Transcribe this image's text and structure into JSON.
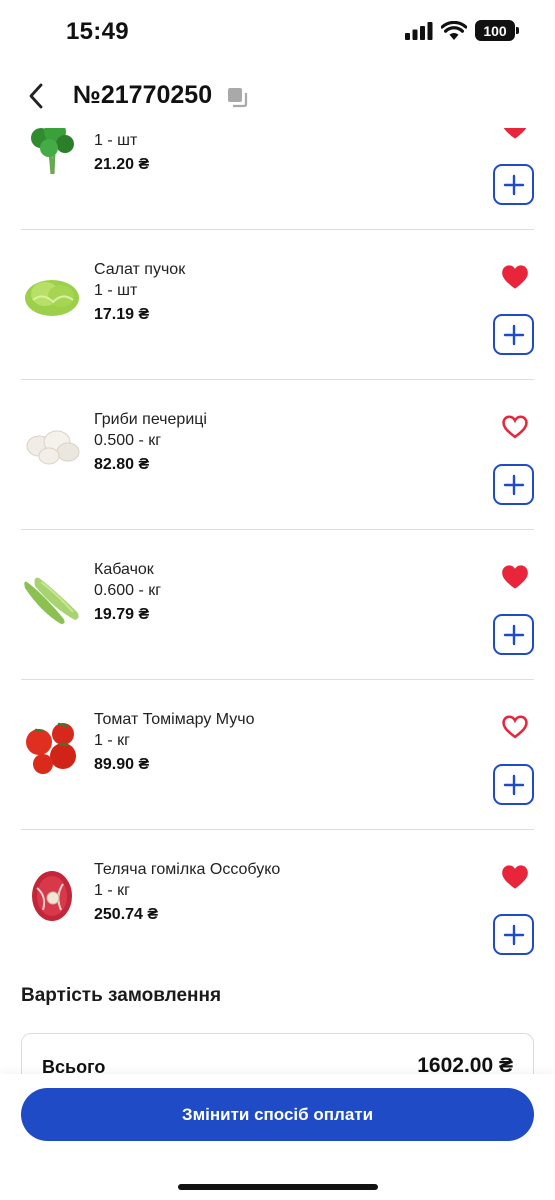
{
  "status_bar": {
    "time": "15:49",
    "battery": "100"
  },
  "header": {
    "order_number": "№21770250"
  },
  "items": [
    {
      "name": "",
      "quantity": "1 - шт",
      "price": "21.20 ₴",
      "favorite": true,
      "image": "herb-bunch"
    },
    {
      "name": "Салат пучок",
      "quantity": "1 - шт",
      "price": "17.19 ₴",
      "favorite": true,
      "image": "lettuce"
    },
    {
      "name": "Гриби печериці",
      "quantity": "0.500 - кг",
      "price": "82.80 ₴",
      "favorite": false,
      "image": "mushrooms"
    },
    {
      "name": "Кабачок",
      "quantity": "0.600 - кг",
      "price": "19.79 ₴",
      "favorite": true,
      "image": "zucchini"
    },
    {
      "name": "Томат Томімару Мучо",
      "quantity": "1 - кг",
      "price": "89.90 ₴",
      "favorite": false,
      "image": "tomatoes"
    },
    {
      "name": "Теляча гомілка Оссобуко",
      "quantity": "1 - кг",
      "price": "250.74 ₴",
      "favorite": true,
      "image": "veal-shank"
    }
  ],
  "order_cost": {
    "title": "Вартість замовлення",
    "total_label": "Всього",
    "total_value": "1602.00 ₴"
  },
  "actions": {
    "change_payment": "Змінити спосіб оплати"
  },
  "colors": {
    "accent": "#1f4bc6",
    "favorite": "#e8253b",
    "divider": "#dedede"
  }
}
